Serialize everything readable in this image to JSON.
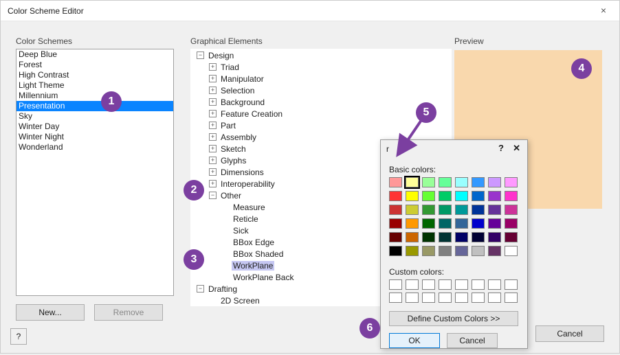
{
  "window": {
    "title": "Color Scheme Editor",
    "close_glyph": "×"
  },
  "sections": {
    "schemes": "Color Schemes",
    "graphical": "Graphical Elements",
    "preview": "Preview"
  },
  "schemes": {
    "items": [
      "Deep Blue",
      "Forest",
      "High Contrast",
      "Light Theme",
      "Millennium",
      "Presentation",
      "Sky",
      "Winter Day",
      "Winter Night",
      "Wonderland"
    ],
    "selected_index": 5,
    "new_label": "New...",
    "remove_label": "Remove"
  },
  "tree": [
    {
      "depth": 0,
      "exp": "-",
      "label": "Design"
    },
    {
      "depth": 1,
      "exp": "+",
      "label": "Triad"
    },
    {
      "depth": 1,
      "exp": "+",
      "label": "Manipulator"
    },
    {
      "depth": 1,
      "exp": "+",
      "label": "Selection"
    },
    {
      "depth": 1,
      "exp": "+",
      "label": "Background"
    },
    {
      "depth": 1,
      "exp": "+",
      "label": "Feature Creation"
    },
    {
      "depth": 1,
      "exp": "+",
      "label": "Part"
    },
    {
      "depth": 1,
      "exp": "+",
      "label": "Assembly"
    },
    {
      "depth": 1,
      "exp": "+",
      "label": "Sketch"
    },
    {
      "depth": 1,
      "exp": "+",
      "label": "Glyphs"
    },
    {
      "depth": 1,
      "exp": "+",
      "label": "Dimensions"
    },
    {
      "depth": 1,
      "exp": "+",
      "label": "Interoperability"
    },
    {
      "depth": 1,
      "exp": "-",
      "label": "Other"
    },
    {
      "depth": 2,
      "exp": "",
      "label": "Measure"
    },
    {
      "depth": 2,
      "exp": "",
      "label": "Reticle"
    },
    {
      "depth": 2,
      "exp": "",
      "label": "Sick"
    },
    {
      "depth": 2,
      "exp": "",
      "label": "BBox Edge"
    },
    {
      "depth": 2,
      "exp": "",
      "label": "BBox Shaded"
    },
    {
      "depth": 2,
      "exp": "",
      "label": "WorkPlane",
      "selected": true
    },
    {
      "depth": 2,
      "exp": "",
      "label": "WorkPlane Back"
    },
    {
      "depth": 0,
      "exp": "-",
      "label": "Drafting"
    },
    {
      "depth": 1,
      "exp": "",
      "label": "2D Screen"
    }
  ],
  "popup": {
    "title_suffix": "r",
    "basic_label": "Basic colors:",
    "custom_label": "Custom colors:",
    "define_label": "Define Custom Colors >>",
    "ok_label": "OK",
    "cancel_label": "Cancel",
    "help_glyph": "?",
    "close_glyph": "✕",
    "basic_colors": [
      "#ff9999",
      "#ffff99",
      "#99ff99",
      "#66ff99",
      "#99ffff",
      "#3399ff",
      "#cc99ff",
      "#ff99ff",
      "#ff3333",
      "#ffff00",
      "#66ff33",
      "#00cc66",
      "#00ffff",
      "#0066cc",
      "#9933cc",
      "#ff33cc",
      "#cc3333",
      "#cccc33",
      "#339933",
      "#009966",
      "#009999",
      "#003399",
      "#663399",
      "#cc3399",
      "#990000",
      "#ff9900",
      "#006600",
      "#006666",
      "#336699",
      "#0000cc",
      "#660099",
      "#990066",
      "#660000",
      "#cc6600",
      "#003300",
      "#003333",
      "#000066",
      "#000033",
      "#330066",
      "#660033",
      "#000000",
      "#999900",
      "#999966",
      "#808080",
      "#666699",
      "#c0c0c0",
      "#663366",
      "#ffffff"
    ],
    "selected_basic_index": 1
  },
  "footer": {
    "cancel_label": "Cancel",
    "help_glyph": "?"
  },
  "callouts": [
    "1",
    "2",
    "3",
    "4",
    "5",
    "6"
  ]
}
